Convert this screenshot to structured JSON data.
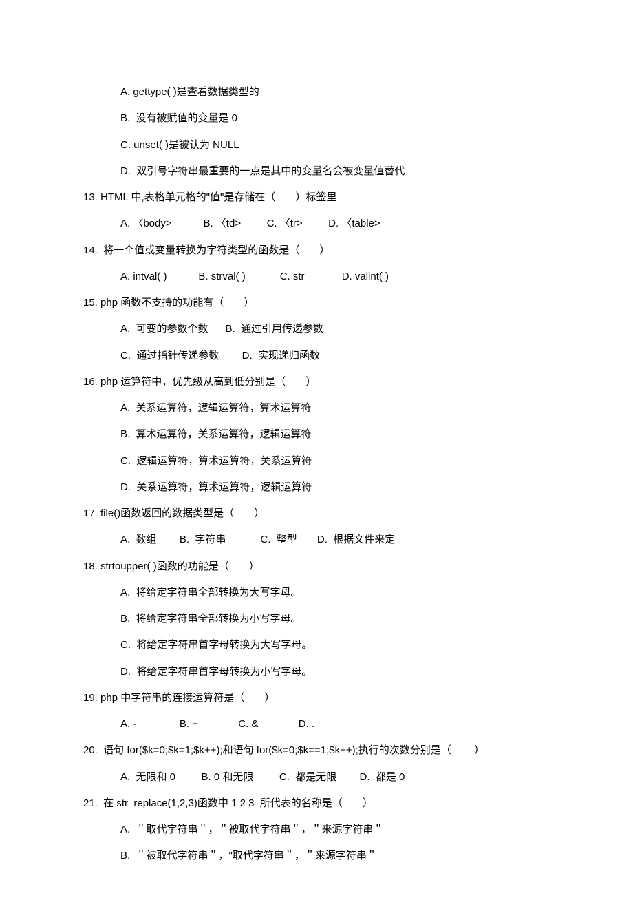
{
  "lines": {
    "q12a": "A. gettype( )是查看数据类型的",
    "q12b": "B.  没有被赋值的变量是 0",
    "q12c": "C. unset( )是被认为 NULL",
    "q12d": "D.  双引号字符串最重要的一点是其中的变量名会被变量值替代",
    "q13": "13. HTML 中,表格单元格的\"值\"是存储在（       ）标签里",
    "q13opts": "A. 〈body>           B. 〈td>         C. 〈tr>         D. 〈table>",
    "q14": "14.  将一个值或变量转换为字符类型的函数是（       ）",
    "q14opts": "A. intval( )           B. strval( )            C. str             D. valint( )",
    "q15": "15. php 函数不支持的功能有（       ）",
    "q15ab": "A.  可变的参数个数      B.  通过引用传递参数",
    "q15cd": "C.  通过指针传递参数        D.  实现递归函数",
    "q16": "16. php 运算符中，优先级从高到低分别是（       ）",
    "q16a": "A.  关系运算符，逻辑运算符，算术运算符",
    "q16b": "B.  算术运算符，关系运算符，逻辑运算符",
    "q16c": "C.  逻辑运算符，算术运算符，关系运算符",
    "q16d": "D.  关系运算符，算术运算符，逻辑运算符",
    "q17": "17. file()函数返回的数据类型是（       ）",
    "q17opts": "A.  数组        B.  字符串            C.  整型       D.  根据文件来定",
    "q18": "18. strtoupper( )函数的功能是（       ）",
    "q18a": "A.  将给定字符串全部转换为大写字母。",
    "q18b": "B.  将给定字符串全部转换为小写字母。",
    "q18c": "C.  将给定字符串首字母转换为大写字母。",
    "q18d": "D.  将给定字符串首字母转换为小写字母。",
    "q19": "19. php 中字符串的连接运算符是（       ）",
    "q19opts": "A. -               B. +              C. &              D. .",
    "q20": "20.  语句 for($k=0;$k=1;$k++);和语句 for($k=0;$k==1;$k++);执行的次数分别是（        ）",
    "q20opts": "A.  无限和 0         B. 0 和无限         C.  都是无限        D.  都是 0",
    "q21": "21.  在 str_replace(1,2,3)函数中 1 2 3  所代表的名称是（       ）",
    "q21a": "A.  ＂取代字符串＂，＂被取代字符串＂，＂来源字符串＂",
    "q21b": "B.  ＂被取代字符串＂，\"取代字符串＂，＂来源字符串＂"
  }
}
